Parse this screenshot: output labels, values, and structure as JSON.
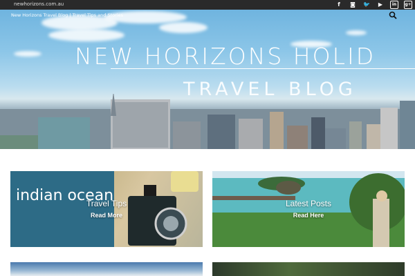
{
  "topbar": {
    "domain": "newhorizons.com.au",
    "socials": [
      {
        "icon": "facebook-icon",
        "glyph": "f"
      },
      {
        "icon": "instagram-icon",
        "glyph": "◙"
      },
      {
        "icon": "twitter-icon",
        "glyph": "🐦"
      },
      {
        "icon": "youtube-icon",
        "glyph": "▶"
      },
      {
        "icon": "linkedin-icon",
        "glyph": "in"
      },
      {
        "icon": "google-plus-icon",
        "glyph": "g+"
      }
    ]
  },
  "hero": {
    "tagline": "New Horizons Travel Blog | Travel Tips and Stories",
    "title": "NEW HORIZONS HOLID",
    "subtitle": "TRAVEL BLOG"
  },
  "cards": [
    {
      "label": "Travel Tips",
      "link": "Read More"
    },
    {
      "label": "Latest Posts",
      "link": "Read Here"
    }
  ],
  "colors": {
    "topbar": "#2a2a2a",
    "white": "#ffffff"
  }
}
